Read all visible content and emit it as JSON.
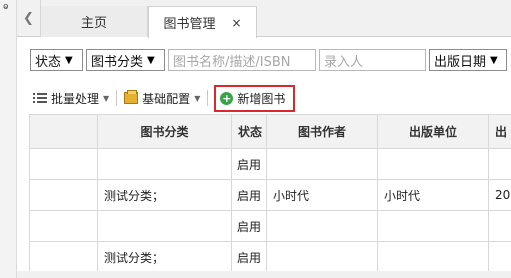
{
  "tabs": [
    {
      "label": "主页"
    },
    {
      "label": "图书管理",
      "close": "×"
    }
  ],
  "pin_glyph": "ⱺ",
  "filters": {
    "status": "状态",
    "category": "图书分类",
    "search_placeholder": "图书名称/描述/ISBN",
    "entry_person_placeholder": "录入人",
    "pub_date": "出版日期"
  },
  "toolbar": {
    "batch": "批量处理",
    "basic_config": "基础配置",
    "add_book": "新增图书"
  },
  "table": {
    "columns": [
      "",
      "图书分类",
      "状态",
      "图书作者",
      "出版单位",
      "出"
    ],
    "rows": [
      {
        "category": "",
        "status": "启用",
        "author": "",
        "publisher": "",
        "extra": ""
      },
      {
        "category": "测试分类；",
        "status": "启用",
        "author": "小时代",
        "publisher": "小时代",
        "extra": "20"
      },
      {
        "category": "",
        "status": "启用",
        "author": "",
        "publisher": "",
        "extra": ""
      },
      {
        "category": "测试分类；",
        "status": "启用",
        "author": "",
        "publisher": "",
        "extra": ""
      }
    ]
  },
  "colors": {
    "highlight": "#d9282e",
    "add_icon": "#3aa34a"
  }
}
